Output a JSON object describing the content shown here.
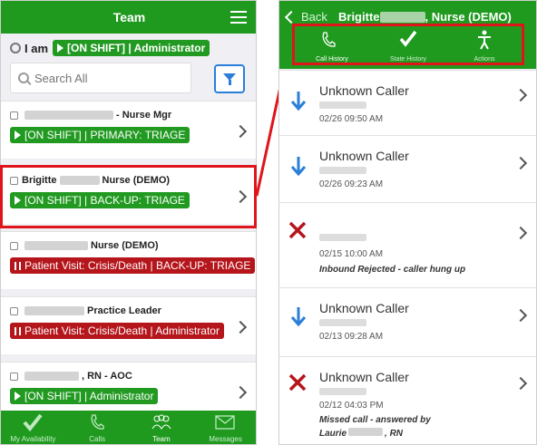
{
  "left": {
    "title": "Team",
    "iam_label": "I am",
    "iam_status": "[ON SHIFT] | Administrator",
    "search_placeholder": "Search All",
    "members": [
      {
        "name_suffix": "- Nurse Mgr",
        "status": "[ON SHIFT] | PRIMARY: TRIAGE",
        "status_color": "green"
      },
      {
        "name_prefix": "Brigitte",
        "name_suffix": "Nurse (DEMO)",
        "status": "[ON SHIFT] | BACK-UP: TRIAGE",
        "status_color": "green"
      },
      {
        "name_suffix": "Nurse (DEMO)",
        "status": "Patient Visit: Crisis/Death | BACK-UP: TRIAGE",
        "status_color": "red"
      },
      {
        "name_suffix": "Practice Leader",
        "status": "Patient Visit: Crisis/Death | Administrator",
        "status_color": "red"
      },
      {
        "name_suffix": ", RN - AOC",
        "status": "[ON SHIFT] | Administrator",
        "status_color": "green"
      }
    ],
    "tabs": [
      "My Availability",
      "Calls",
      "Team",
      "Messages"
    ],
    "active_tab": "Team"
  },
  "right": {
    "back_label": "Back",
    "contact_first": "Brigitte",
    "contact_last": ", Nurse (DEMO)",
    "subtabs": [
      "Call History",
      "State History",
      "Actions"
    ],
    "active_subtab": "Call History",
    "calls": [
      {
        "type": "incoming",
        "name": "Unknown Caller",
        "time": "02/26 09:50 AM"
      },
      {
        "type": "incoming",
        "name": "Unknown Caller",
        "time": "02/26 09:23 AM"
      },
      {
        "type": "rejected",
        "name": "",
        "time": "02/15 10:00 AM",
        "note": "Inbound Rejected - caller hung up"
      },
      {
        "type": "incoming",
        "name": "Unknown Caller",
        "time": "02/13 09:28 AM"
      },
      {
        "type": "missed",
        "name": "Unknown Caller",
        "time": "02/12 04:03 PM",
        "note": "Missed call - answered by",
        "note2_prefix": "Laurie",
        "note2_suffix": ", RN"
      }
    ]
  },
  "colors": {
    "brand_green": "#1f9a1f",
    "status_red": "#b5161c",
    "highlight": "#e0141b",
    "accent_blue": "#2a7fd9"
  }
}
